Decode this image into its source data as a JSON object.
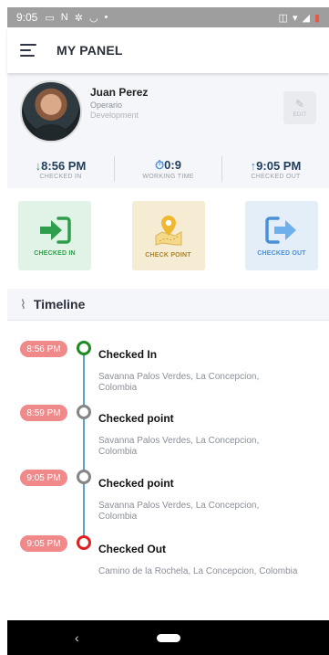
{
  "status_bar": {
    "time": "9:05",
    "left_icons": [
      "message-icon",
      "notification-icon",
      "settings-icon",
      "app-icon",
      "dot-icon"
    ],
    "right_icons": [
      "vibrate-icon",
      "wifi-icon",
      "signal-icon",
      "battery-icon"
    ]
  },
  "app_bar": {
    "title": "MY PANEL"
  },
  "profile": {
    "name": "Juan Perez",
    "role": "Operario",
    "department": "Development",
    "edit_label": "EDIT"
  },
  "times": {
    "checked_in": {
      "value": "8:56 PM",
      "label": "CHECKED IN"
    },
    "working": {
      "value": "0:9",
      "label": "WORKING TIME"
    },
    "checked_out": {
      "value": "9:05 PM",
      "label": "CHECKED OUT"
    }
  },
  "actions": [
    {
      "label": "CHECKED IN",
      "icon": "login-arrow-icon"
    },
    {
      "label": "CHECK POINT",
      "icon": "map-pin-icon"
    },
    {
      "label": "CHECKED OUT",
      "icon": "logout-arrow-icon"
    }
  ],
  "timeline": {
    "title": "Timeline",
    "events": [
      {
        "time": "8:56 PM",
        "title": "Checked In",
        "address": "Savanna Palos Verdes, La Concepcion, Colombia",
        "status_color": "#1e8a22"
      },
      {
        "time": "8:59 PM",
        "title": "Checked point",
        "address": "Savanna Palos Verdes, La Concepcion, Colombia",
        "status_color": "#858585"
      },
      {
        "time": "9:05 PM",
        "title": "Checked point",
        "address": "Savanna Palos Verdes, La Concepcion, Colombia",
        "status_color": "#858585"
      },
      {
        "time": "9:05 PM",
        "title": "Checked Out",
        "address": "Camino de la Rochela, La Concepcion, Colombia",
        "status_color": "#e02020"
      }
    ]
  },
  "nav_bar": {
    "back_icon": "back-chevron-icon",
    "home_icon": "home-pill-icon"
  }
}
